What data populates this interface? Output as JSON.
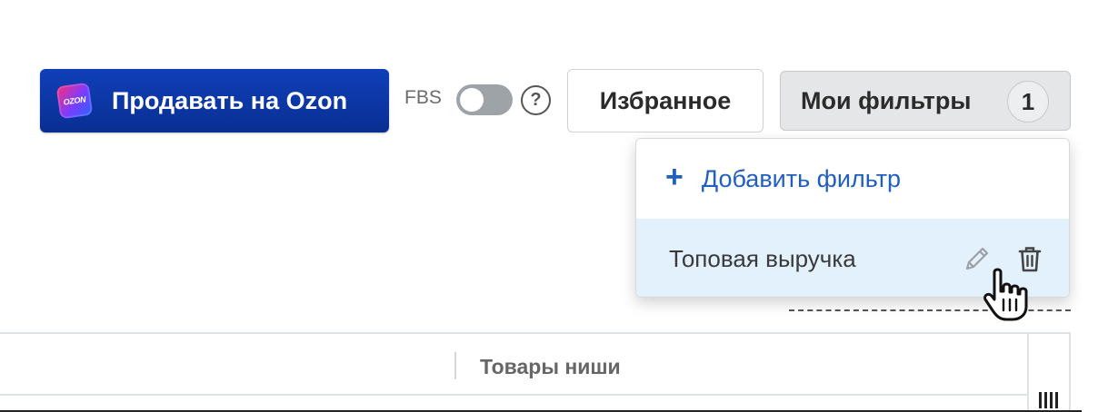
{
  "header": {
    "sell_button_label": "Продавать на Ozon",
    "ozon_logo_text": "OZON",
    "fbs_label": "FBS",
    "fbs_toggle_on": false,
    "help_symbol": "?",
    "favorites_label": "Избранное",
    "my_filters_label": "Мои фильтры",
    "my_filters_count": "1"
  },
  "dropdown": {
    "add_symbol": "+",
    "add_filter_label": "Добавить фильтр",
    "items": [
      {
        "name": "Топовая выручка"
      }
    ]
  },
  "table": {
    "columns": [
      "Товары ниши"
    ]
  },
  "icons": {
    "help": "help-icon",
    "plus": "plus-icon",
    "edit": "pencil-icon",
    "delete": "trash-icon",
    "cursor": "hand-pointer-icon",
    "columns": "columns-settings-icon"
  },
  "colors": {
    "brand_blue": "#0a2f93",
    "link_blue": "#1f5fbf",
    "highlight_row": "#e3f1fc",
    "toggle_off": "#9ea3a8"
  }
}
